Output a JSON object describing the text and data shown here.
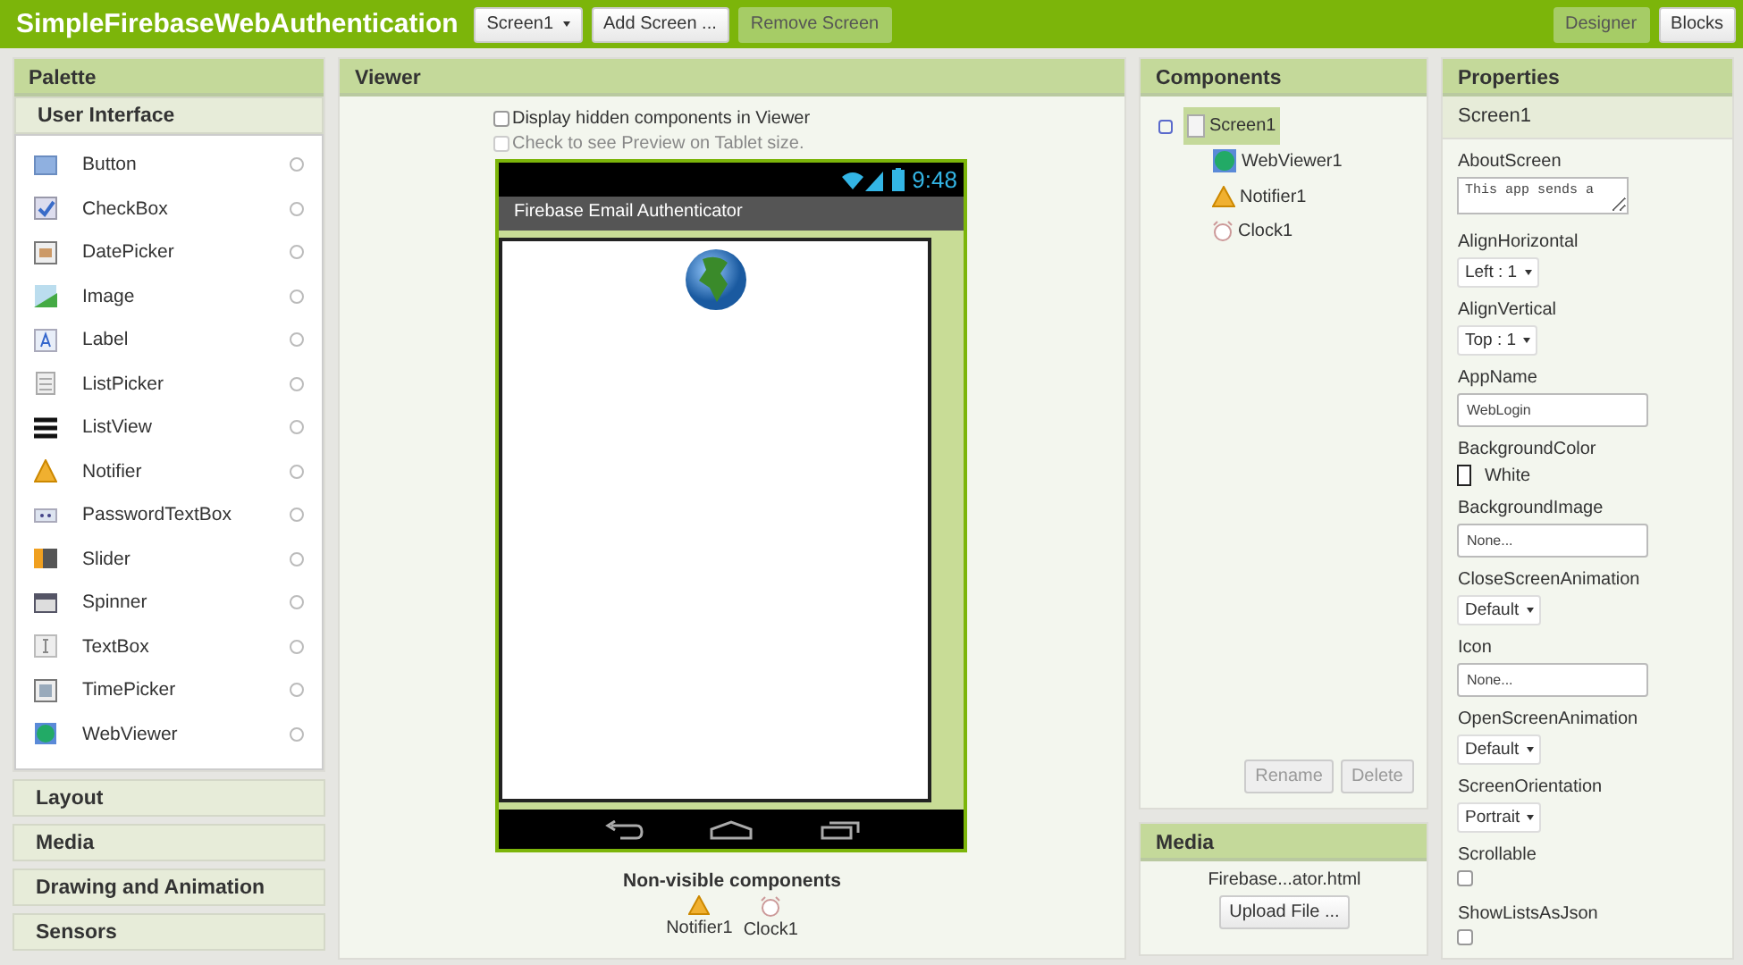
{
  "topbar": {
    "project_title": "SimpleFirebaseWebAuthentication",
    "screen_dropdown": "Screen1",
    "buttons": [
      {
        "label": "Add Screen ...",
        "disabled": false
      },
      {
        "label": "Remove Screen",
        "disabled": true
      }
    ],
    "views": [
      {
        "label": "Designer",
        "selected": true
      },
      {
        "label": "Blocks",
        "selected": false
      }
    ]
  },
  "palette": {
    "title": "Palette",
    "open_section": "User Interface",
    "items": [
      {
        "label": "Button"
      },
      {
        "label": "CheckBox"
      },
      {
        "label": "DatePicker"
      },
      {
        "label": "Image"
      },
      {
        "label": "Label"
      },
      {
        "label": "ListPicker"
      },
      {
        "label": "ListView"
      },
      {
        "label": "Notifier"
      },
      {
        "label": "PasswordTextBox"
      },
      {
        "label": "Slider"
      },
      {
        "label": "Spinner"
      },
      {
        "label": "TextBox"
      },
      {
        "label": "TimePicker"
      },
      {
        "label": "WebViewer"
      }
    ],
    "sections": [
      "Layout",
      "Media",
      "Drawing and Animation",
      "Sensors"
    ]
  },
  "viewer": {
    "title": "Viewer",
    "options": [
      {
        "label": "Display hidden components in Viewer",
        "checked": false,
        "disabled": false
      },
      {
        "label": "Check to see Preview on Tablet size.",
        "checked": false,
        "disabled": true
      }
    ],
    "phone": {
      "time": "9:48",
      "app_title": "Firebase Email Authenticator"
    },
    "nonvisible_title": "Non-visible components",
    "nonvisible": [
      {
        "label": "Notifier1"
      },
      {
        "label": "Clock1"
      }
    ]
  },
  "components": {
    "title": "Components",
    "tree": [
      {
        "label": "Screen1",
        "selected": true,
        "expanded": true,
        "children": [
          {
            "label": "WebViewer1",
            "selected": false
          },
          {
            "label": "Notifier1",
            "selected": false
          },
          {
            "label": "Clock1",
            "selected": false
          }
        ]
      }
    ],
    "buttons": [
      {
        "label": "Rename",
        "disabled": true
      },
      {
        "label": "Delete",
        "disabled": true
      }
    ]
  },
  "media": {
    "title": "Media",
    "files": [
      "Firebase...ator.html"
    ],
    "upload": "Upload File ..."
  },
  "properties": {
    "title": "Properties",
    "component": "Screen1",
    "items": [
      {
        "kind": "textarea",
        "name": "AboutScreen",
        "value": "This app sends a"
      },
      {
        "kind": "dropdown",
        "name": "AlignHorizontal",
        "value": "Left : 1"
      },
      {
        "kind": "dropdown",
        "name": "AlignVertical",
        "value": "Top : 1"
      },
      {
        "kind": "text",
        "name": "AppName",
        "value": "WebLogin"
      },
      {
        "kind": "color",
        "name": "BackgroundColor",
        "value": "White",
        "color": "#ffffff"
      },
      {
        "kind": "text",
        "name": "BackgroundImage",
        "value": "None..."
      },
      {
        "kind": "dropdown",
        "name": "CloseScreenAnimation",
        "value": "Default"
      },
      {
        "kind": "text",
        "name": "Icon",
        "value": "None..."
      },
      {
        "kind": "dropdown",
        "name": "OpenScreenAnimation",
        "value": "Default"
      },
      {
        "kind": "dropdown",
        "name": "ScreenOrientation",
        "value": "Portrait"
      },
      {
        "kind": "checkbox",
        "name": "Scrollable",
        "checked": false
      },
      {
        "kind": "checkbox",
        "name": "ShowListsAsJson",
        "checked": false
      }
    ]
  }
}
